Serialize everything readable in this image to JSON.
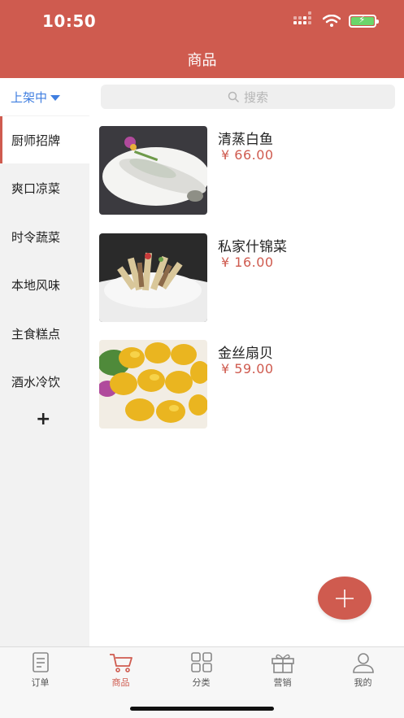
{
  "status": {
    "time": "10:50"
  },
  "header": {
    "title": "商品"
  },
  "filter": {
    "label": "上架中"
  },
  "categories": [
    {
      "label": "厨师招牌",
      "active": true
    },
    {
      "label": "爽口凉菜",
      "active": false
    },
    {
      "label": "时令蔬菜",
      "active": false
    },
    {
      "label": "本地风味",
      "active": false
    },
    {
      "label": "主食糕点",
      "active": false
    },
    {
      "label": "酒水冷饮",
      "active": false
    }
  ],
  "add_category_label": "+",
  "search": {
    "placeholder": "搜索",
    "icon": "search-icon"
  },
  "products": [
    {
      "name": "清蒸白鱼",
      "price": "¥ 66.00",
      "image": "steamed-fish-photo"
    },
    {
      "name": "私家什锦菜",
      "price": "¥ 16.00",
      "image": "mixed-vegetables-photo"
    },
    {
      "name": "金丝扇贝",
      "price": "¥ 59.00",
      "image": "golden-scallops-photo"
    }
  ],
  "fab": {
    "icon": "plus-icon"
  },
  "tabs": [
    {
      "label": "订单",
      "icon": "document-icon",
      "active": false
    },
    {
      "label": "商品",
      "icon": "cart-icon",
      "active": true
    },
    {
      "label": "分类",
      "icon": "grid-icon",
      "active": false
    },
    {
      "label": "营销",
      "icon": "gift-icon",
      "active": false
    },
    {
      "label": "我的",
      "icon": "user-icon",
      "active": false
    }
  ],
  "colors": {
    "accent": "#cf5b4f",
    "link": "#3f7ee0",
    "sidebar_bg": "#f2f2f2"
  }
}
